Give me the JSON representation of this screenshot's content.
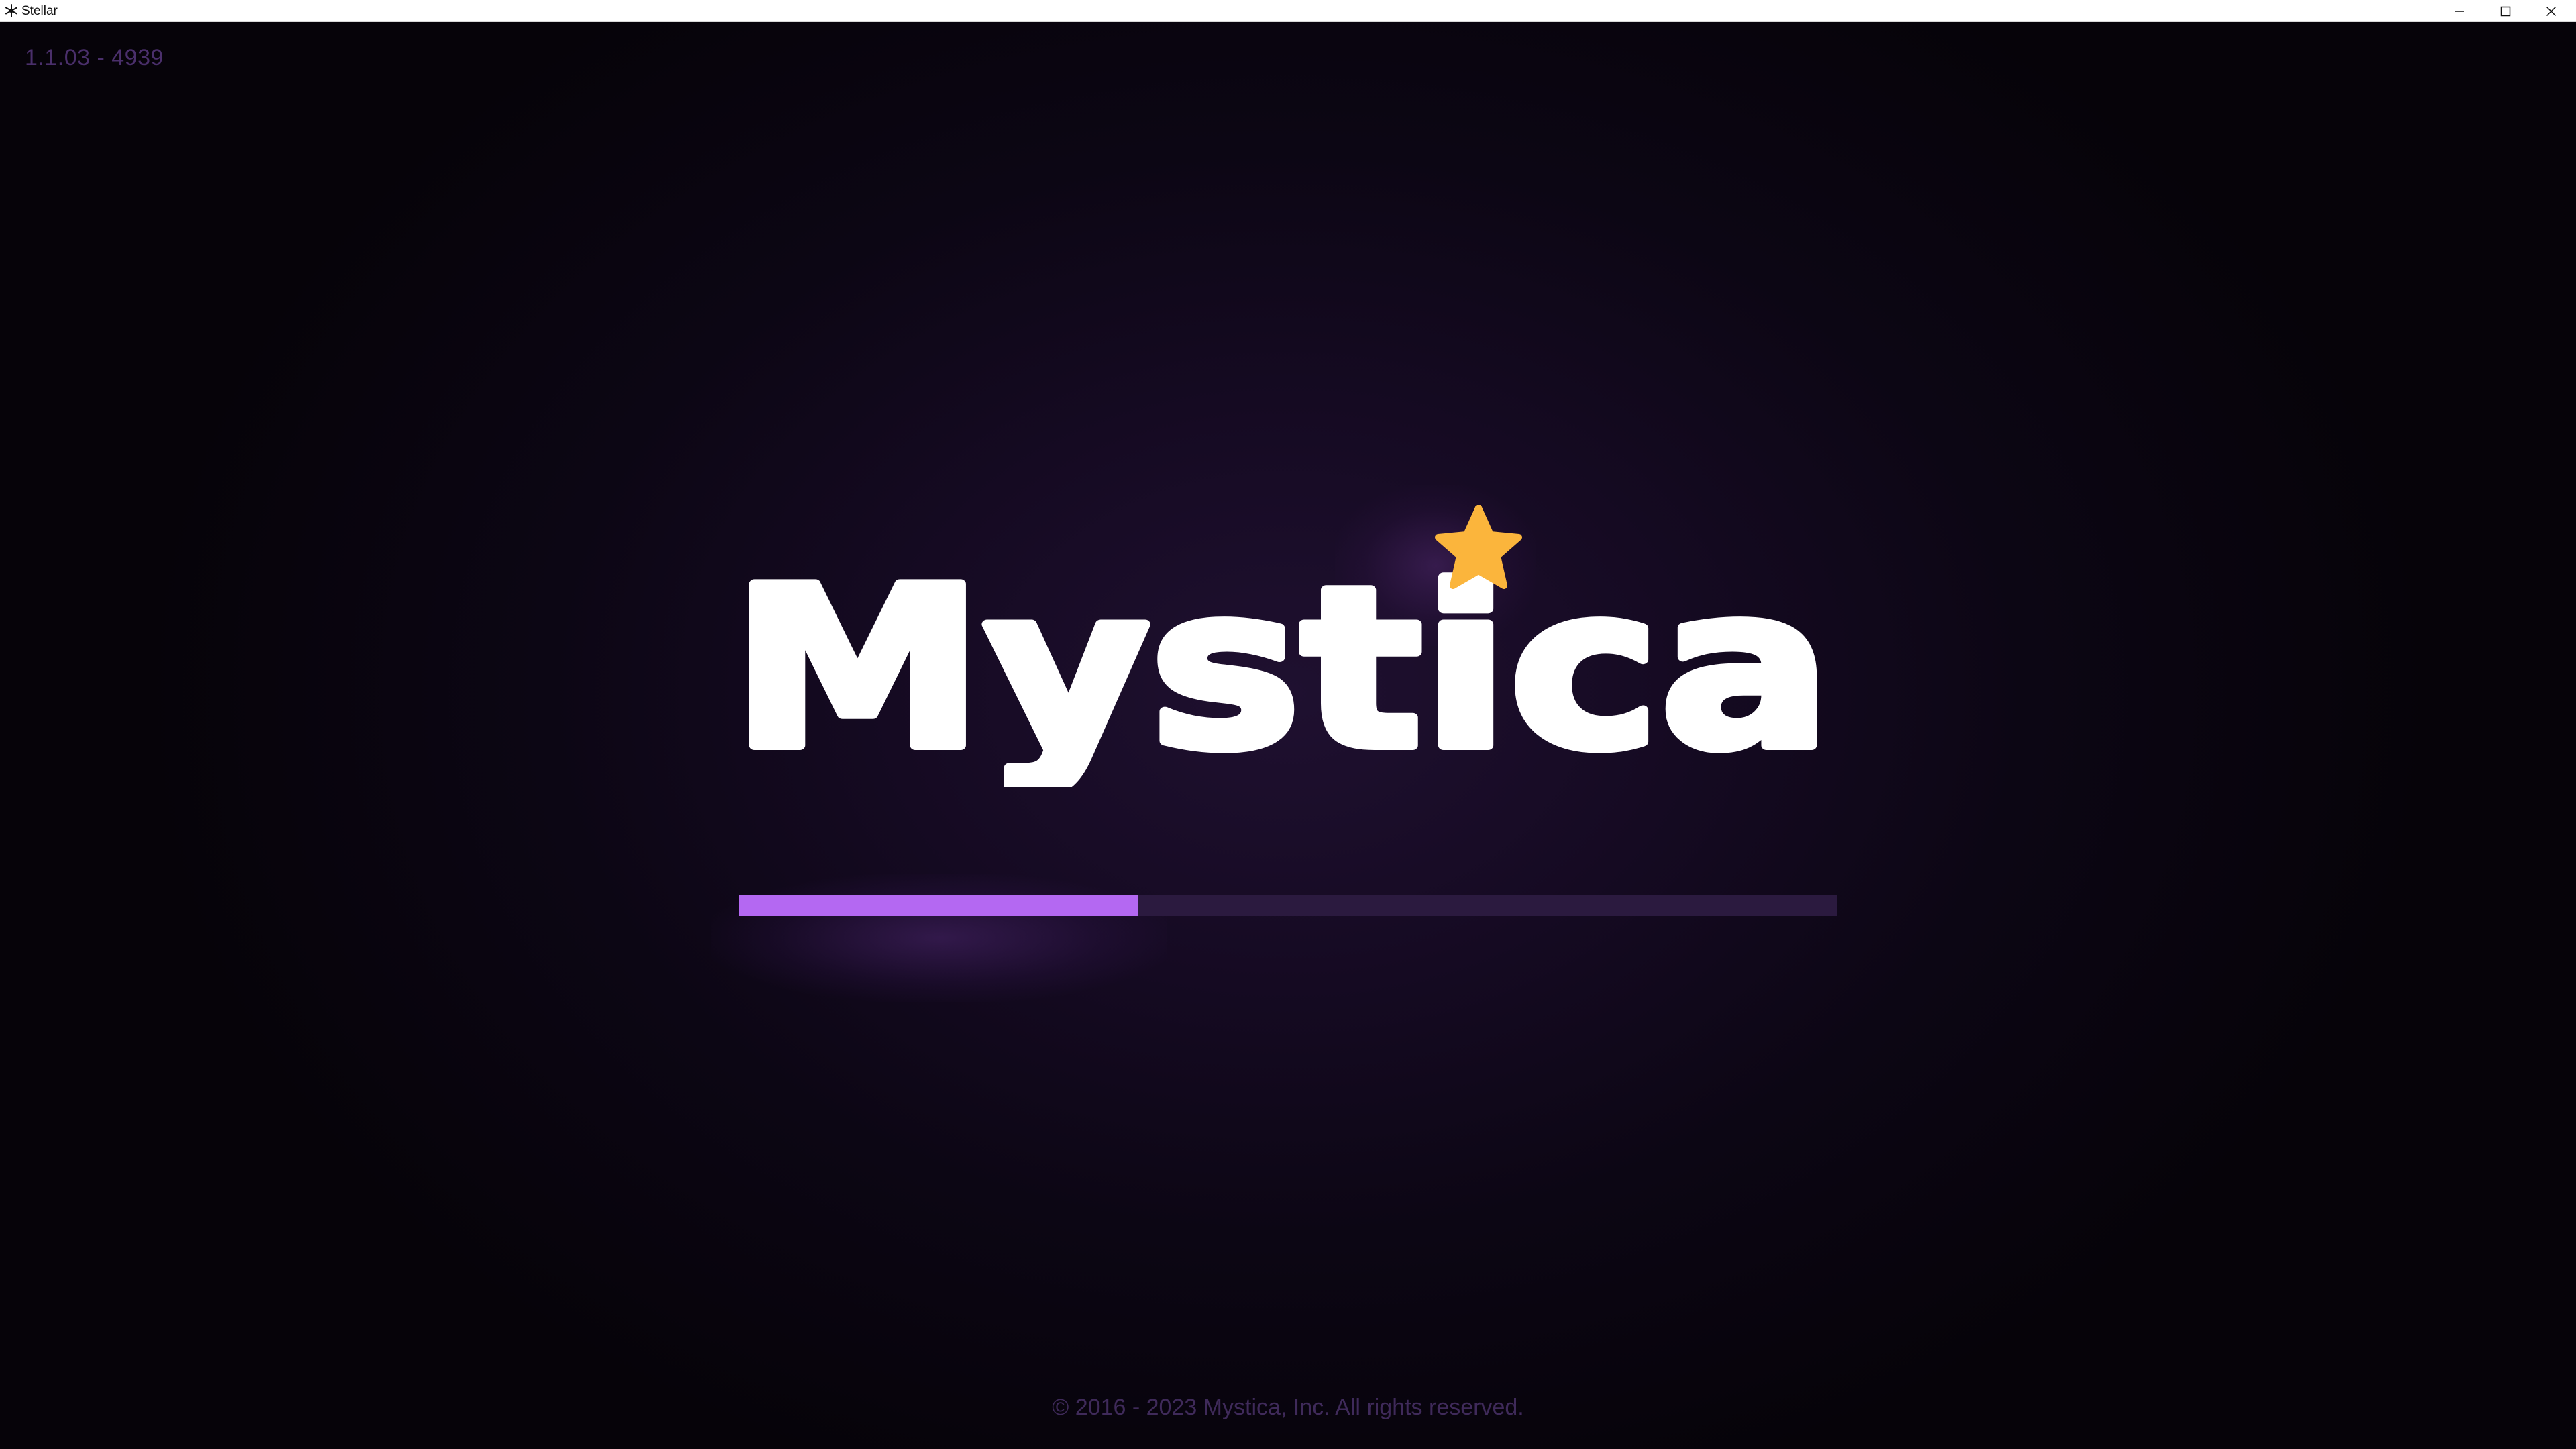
{
  "window": {
    "title": "Stellar",
    "icon": "stellar-app-icon",
    "controls": {
      "minimize_icon": "minimize-icon",
      "maximize_icon": "maximize-icon",
      "close_icon": "close-icon"
    }
  },
  "splash": {
    "version": "1.1.03 - 4939",
    "logo_text": "Mystica",
    "logo_star_color": "#fbb53c",
    "progress": {
      "fraction": 0.363,
      "fill_color": "#b468f2",
      "track_color": "#2b1a3f"
    },
    "copyright": "© 2016 - 2023 Mystica, Inc. All rights reserved."
  },
  "colors": {
    "background": "#0c0614",
    "text_muted": "#4a2f6b"
  }
}
